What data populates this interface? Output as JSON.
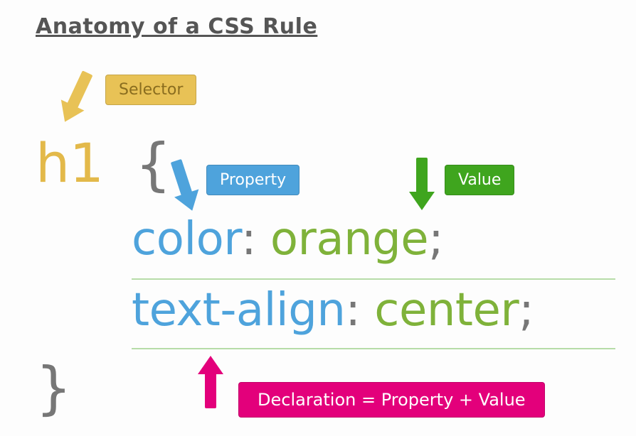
{
  "title": "Anatomy of a CSS Rule",
  "labels": {
    "selector": "Selector",
    "property": "Property",
    "value": "Value",
    "declaration": "Declaration = Property + Value"
  },
  "code": {
    "selector": "h1",
    "brace_open": "{",
    "brace_close": "}",
    "decl1": {
      "property": "color",
      "colonspace": ": ",
      "value": "orange",
      "semicolon": ";"
    },
    "decl2": {
      "property": "text-align",
      "colonspace": ": ",
      "value": "center",
      "semicolon": ";"
    }
  },
  "colors": {
    "selector_label": "#e8c256",
    "property_label": "#4ea3dc",
    "value_label": "#3fa51e",
    "declaration_label": "#e3007b",
    "selector_text": "#e3b94a",
    "property_text": "#4ea3dc",
    "value_text": "#7fb23a",
    "punctuation": "#777777"
  }
}
